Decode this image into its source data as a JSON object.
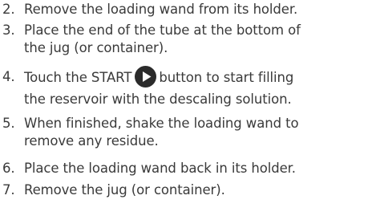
{
  "steps": [
    {
      "number": "2.",
      "lines": [
        "Remove the loading wand from its holder."
      ]
    },
    {
      "number": "3.",
      "lines": [
        "Place the end of the tube at the bottom of",
        "the jug (or container)."
      ]
    },
    {
      "number": "4.",
      "before_icon": "Touch the START",
      "icon": "play-icon",
      "after_icon": "button to start filling",
      "lines": [
        "the reservoir with the descaling solution."
      ]
    },
    {
      "number": "5.",
      "lines": [
        "When finished, shake the loading wand to",
        "remove any residue."
      ]
    },
    {
      "number": "6.",
      "lines": [
        "Place the loading wand back in its holder."
      ]
    },
    {
      "number": "7.",
      "lines": [
        "Remove the jug (or container)."
      ]
    }
  ],
  "colors": {
    "text": "#3a3a3a",
    "button": "#2b2b2b",
    "button_icon": "#ffffff"
  }
}
